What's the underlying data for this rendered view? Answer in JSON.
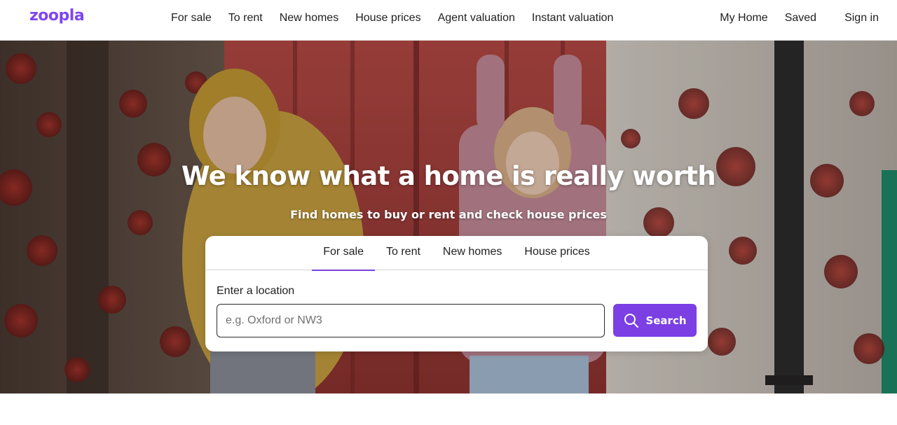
{
  "brand": {
    "logo_text": "zoopla",
    "accent": "#7b3fe4",
    "logo_color": "#8046f1"
  },
  "nav": {
    "items": [
      {
        "label": "For sale"
      },
      {
        "label": "To rent"
      },
      {
        "label": "New homes"
      },
      {
        "label": "House prices"
      },
      {
        "label": "Agent valuation"
      },
      {
        "label": "Instant valuation"
      }
    ],
    "right": [
      {
        "label": "My Home"
      },
      {
        "label": "Saved"
      },
      {
        "label": "Sign in"
      }
    ]
  },
  "hero": {
    "headline": "We know what a home is really worth",
    "subheadline": "Find homes to buy or rent and check house prices"
  },
  "search": {
    "tabs": [
      {
        "label": "For sale",
        "active": true
      },
      {
        "label": "To rent",
        "active": false
      },
      {
        "label": "New homes",
        "active": false
      },
      {
        "label": "House prices",
        "active": false
      }
    ],
    "field_label": "Enter a location",
    "placeholder": "e.g. Oxford or NW3",
    "value": "",
    "button_label": "Search",
    "button_icon": "search-icon"
  }
}
